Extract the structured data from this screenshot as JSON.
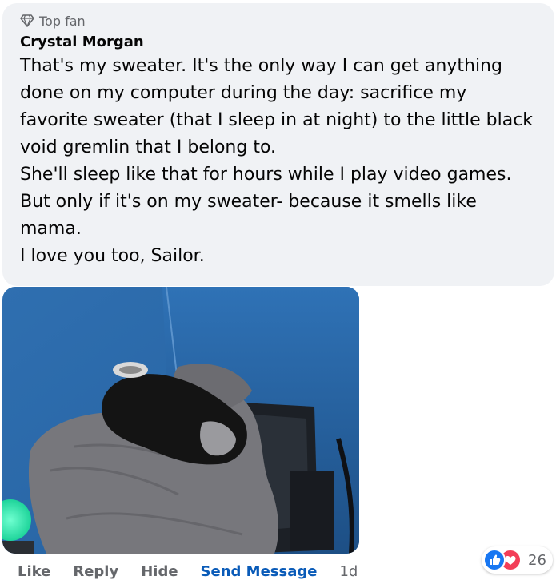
{
  "comment": {
    "badge": "Top fan",
    "author": "Crystal Morgan",
    "lines": [
      "That's my sweater. It's the only way I can get anything",
      "done on my computer during the day: sacrifice my",
      "favorite sweater (that I sleep in at night) to the little black",
      "void gremlin that I belong to.",
      "She'll sleep like that for hours while I play video games.",
      "But only if it's on my sweater- because it smells like",
      "mama.",
      "I love you too, Sailor."
    ]
  },
  "actions": {
    "like": "Like",
    "reply": "Reply",
    "hide": "Hide",
    "send_message": "Send Message",
    "time": "1d"
  },
  "reactions": {
    "count": "26",
    "types": [
      "like-icon",
      "love-icon"
    ]
  },
  "colors": {
    "bubble": "#f0f2f5",
    "link": "#0a5bb8",
    "like": "#1877f2",
    "love": "#f33e58"
  }
}
